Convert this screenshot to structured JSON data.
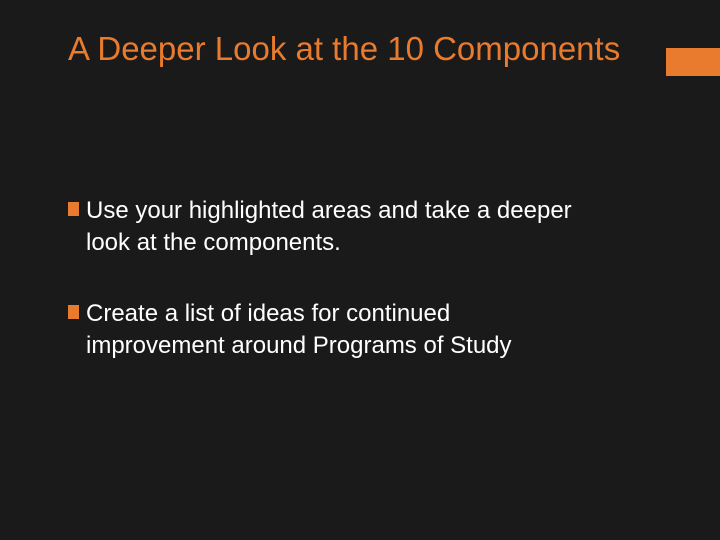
{
  "title": "A Deeper Look at the 10 Components",
  "bullets": [
    "Use your highlighted areas and take a deeper look at the components.",
    "Create a list of ideas for continued improvement around Programs of Study"
  ]
}
